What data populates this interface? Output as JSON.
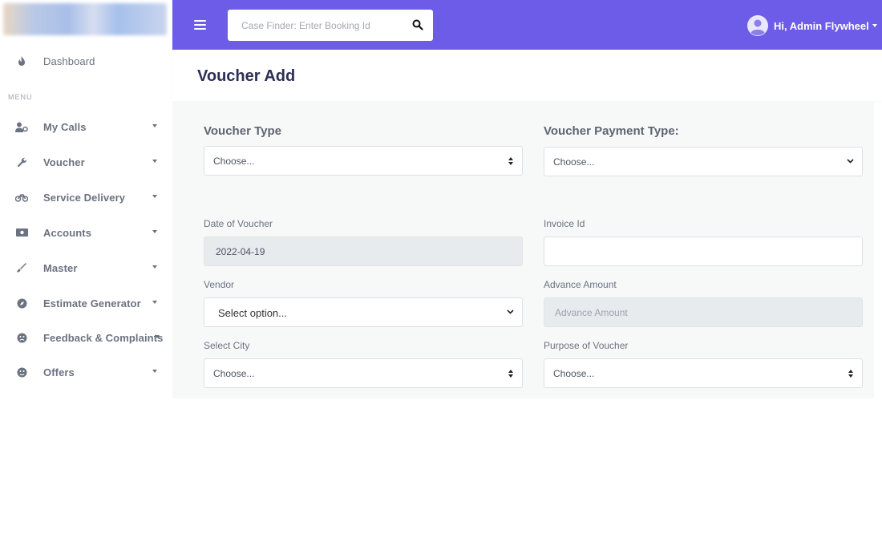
{
  "header": {
    "search_placeholder": "Case Finder: Enter Booking Id",
    "user_name": "Hi, Admin Flywheel"
  },
  "sidebar": {
    "menu_title": "MENU",
    "dashboard": {
      "label": "Dashboard",
      "icon": "fire-icon"
    },
    "items": [
      {
        "label": "My Calls",
        "icon": "user-cog-icon"
      },
      {
        "label": "Voucher",
        "icon": "wrench-icon"
      },
      {
        "label": "Service Delivery",
        "icon": "motorcycle-icon"
      },
      {
        "label": "Accounts",
        "icon": "money-bill-icon"
      },
      {
        "label": "Master",
        "icon": "brush-icon"
      },
      {
        "label": "Estimate Generator",
        "icon": "compass-icon"
      },
      {
        "label": "Feedback & Complaints",
        "icon": "frown-icon"
      },
      {
        "label": "Offers",
        "icon": "smile-icon"
      }
    ]
  },
  "page": {
    "title": "Voucher Add"
  },
  "form": {
    "voucher_type": {
      "label": "Voucher Type",
      "value": "Choose..."
    },
    "payment_type": {
      "label": "Voucher Payment Type:",
      "value": "Choose..."
    },
    "date": {
      "label": "Date of Voucher",
      "value": "2022-04-19"
    },
    "invoice_id": {
      "label": "Invoice Id",
      "value": ""
    },
    "vendor": {
      "label": "Vendor",
      "value": "Select option..."
    },
    "advance_amount": {
      "label": "Advance Amount",
      "placeholder": "Advance Amount"
    },
    "city": {
      "label": "Select City",
      "value": "Choose..."
    },
    "purpose": {
      "label": "Purpose of Voucher",
      "value": "Choose..."
    }
  },
  "colors": {
    "topbar": "#6c5ce7",
    "title": "#2d2f55",
    "form_bg": "#f7f9f9"
  }
}
